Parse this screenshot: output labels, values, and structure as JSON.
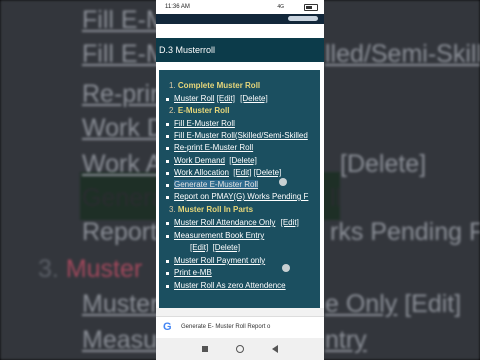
{
  "status": {
    "time": "11:36 AM",
    "network": "4G"
  },
  "page_title": "D.3 Musterroll",
  "sections": [
    {
      "num": "1.",
      "title": "Complete Muster Roll"
    },
    {
      "num": "2.",
      "title": "E-Muster Roll"
    },
    {
      "num": "3.",
      "title": "Muster Roll In Parts"
    }
  ],
  "s1": {
    "muster_roll": "Muster Roll",
    "edit": "[Edit]",
    "delete": "[Delete]"
  },
  "s2": {
    "fill": "Fill E-Muster Roll",
    "fill_skilled": "Fill E-Muster Roll(Skilled/Semi-Skilled",
    "reprint": "Re-print E-Muster Roll",
    "work_demand": "Work Demand",
    "work_demand_delete": "[Delete]",
    "work_allocation": "Work Allocation",
    "work_allocation_edit": "[Edit]",
    "work_allocation_delete": "[Delete]",
    "generate": "Generate E-Muster Roll",
    "report_pmay": "Report on PMAY(G) Works Pending F"
  },
  "s3": {
    "attendance": "Muster Roll Attendance Only",
    "attendance_edit": "[Edit]",
    "mb_entry": "Measurement Book Entry",
    "mb_edit": "[Edit]",
    "mb_delete": "[Delete]",
    "payment": "Muster Roll Payment only",
    "print_emb": "Print e-MB",
    "zero": "Muster Roll As zero Attendence"
  },
  "google_bar": {
    "logo": "G",
    "query": "Generate E- Muster Roll Report o"
  },
  "background": {
    "l1": "Fill E-Mu",
    "l2a": "Fill E-Mu",
    "l2b": "lled/Semi-Skille",
    "l3": "Re-prin",
    "l4": "Work De",
    "l5a": "Work Al",
    "l5b": "[Delete]",
    "l6a": "Genera",
    "l6b": "ll",
    "l7a": "Report",
    "l7b": "rks Pending F",
    "l8a": "3.",
    "l8b": "Muster",
    "l9a": "Muster",
    "l9b": "e Only",
    "l9c": "[Edit]",
    "l10a": "Measu",
    "l10b": "ntry"
  }
}
